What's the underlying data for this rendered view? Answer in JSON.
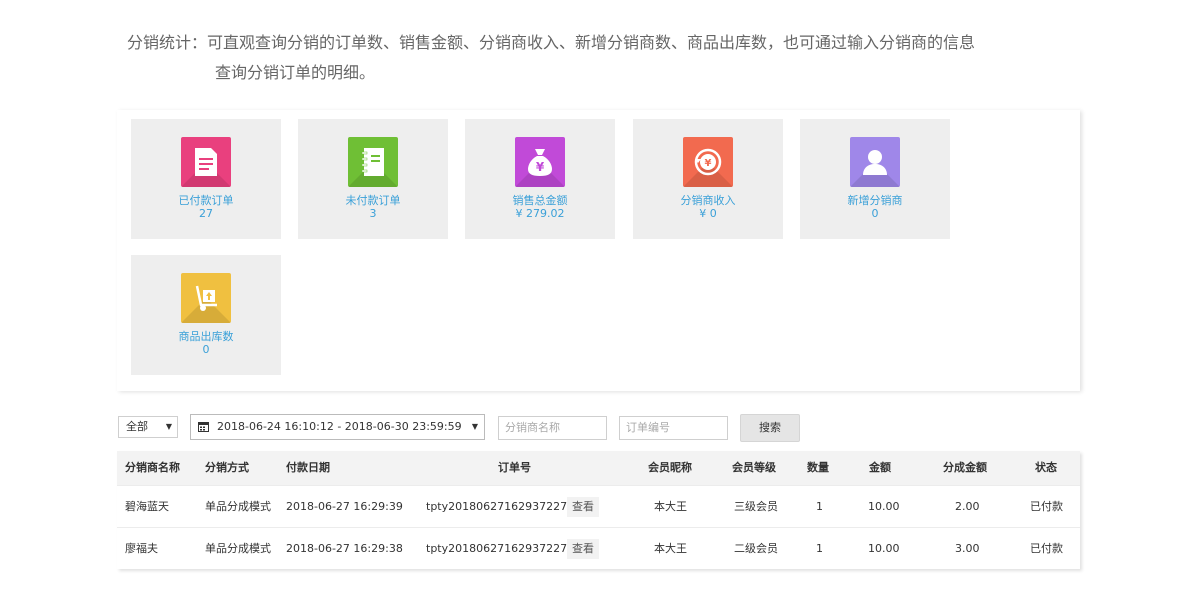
{
  "intro": {
    "line1": "分销统计：可直观查询分销的订单数、销售金额、分销商收入、新增分销商数、商品出库数，也可通过输入分销商的信息",
    "line2": "查询分销订单的明细。"
  },
  "cards": [
    {
      "label": "已付款订单",
      "value": "27",
      "icon": "document-icon",
      "color": "#e9407e"
    },
    {
      "label": "未付款订单",
      "value": "3",
      "icon": "notebook-icon",
      "color": "#6fbf35"
    },
    {
      "label": "销售总金额",
      "value": "¥ 279.02",
      "icon": "money-bag-icon",
      "color": "#c14ad8"
    },
    {
      "label": "分销商收入",
      "value": "¥ 0",
      "icon": "coin-refund-icon",
      "color": "#f26a4f"
    },
    {
      "label": "新增分销商",
      "value": "0",
      "icon": "user-icon",
      "color": "#9f87e9"
    },
    {
      "label": "商品出库数",
      "value": "0",
      "icon": "handcart-icon",
      "color": "#f0c040"
    }
  ],
  "filters": {
    "scope": "全部",
    "date_range": "2018-06-24 16:10:12 - 2018-06-30 23:59:59",
    "distributor_placeholder": "分销商名称",
    "order_placeholder": "订单编号",
    "search_label": "搜索"
  },
  "table": {
    "headers": [
      "分销商名称",
      "分销方式",
      "付款日期",
      "订单号",
      "会员昵称",
      "会员等级",
      "数量",
      "金额",
      "分成金额",
      "状态"
    ],
    "rows": [
      {
        "name": "碧海蓝天",
        "mode": "单品分成模式",
        "date": "2018-06-27 16:29:39",
        "order": "tpty201806271629372275",
        "view": "查看",
        "nickname": "本大王",
        "level": "三级会员",
        "qty": "1",
        "amount": "10.00",
        "share": "2.00",
        "status": "已付款"
      },
      {
        "name": "廖福夫",
        "mode": "单品分成模式",
        "date": "2018-06-27 16:29:38",
        "order": "tpty201806271629372275",
        "view": "查看",
        "nickname": "本大王",
        "level": "二级会员",
        "qty": "1",
        "amount": "10.00",
        "share": "3.00",
        "status": "已付款"
      }
    ]
  }
}
